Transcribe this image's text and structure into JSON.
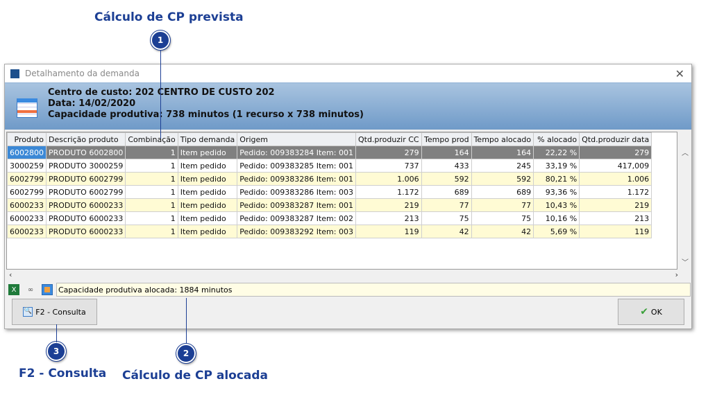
{
  "callouts": {
    "c1": {
      "num": "1",
      "title": "Cálculo de CP prevista"
    },
    "c2": {
      "num": "2",
      "title": "Cálculo de CP alocada"
    },
    "c3": {
      "num": "3",
      "title": "F2 - Consulta"
    }
  },
  "window": {
    "title": "Detalhamento da demanda",
    "close": "✕"
  },
  "header": {
    "centro": "Centro de custo: 202 CENTRO DE CUSTO 202",
    "data": "Data: 14/02/2020",
    "capacidade": "Capacidade produtiva: 738 minutos (1 recurso x 738 minutos)"
  },
  "table": {
    "columns": [
      "Produto",
      "Descrição produto",
      "Combinação",
      "Tipo demanda",
      "Origem",
      "Qtd.produzir CC",
      "Tempo prod",
      "Tempo alocado",
      "% alocado",
      "Qtd.produzir data"
    ],
    "rows": [
      [
        "6002800",
        "PRODUTO 6002800",
        "1",
        "Item pedido",
        "Pedido: 009383284 Item: 001",
        "279",
        "164",
        "164",
        "22,22 %",
        "279"
      ],
      [
        "3000259",
        "PRODUTO 3000259",
        "1",
        "Item pedido",
        "Pedido: 009383285 Item: 001",
        "737",
        "433",
        "245",
        "33,19 %",
        "417,009"
      ],
      [
        "6002799",
        "PRODUTO 6002799",
        "1",
        "Item pedido",
        "Pedido: 009383286 Item: 001",
        "1.006",
        "592",
        "592",
        "80,21 %",
        "1.006"
      ],
      [
        "6002799",
        "PRODUTO 6002799",
        "1",
        "Item pedido",
        "Pedido: 009383286 Item: 003",
        "1.172",
        "689",
        "689",
        "93,36 %",
        "1.172"
      ],
      [
        "6000233",
        "PRODUTO 6000233",
        "1",
        "Item pedido",
        "Pedido: 009383287 Item: 001",
        "219",
        "77",
        "77",
        "10,43 %",
        "219"
      ],
      [
        "6000233",
        "PRODUTO 6000233",
        "1",
        "Item pedido",
        "Pedido: 009383287 Item: 002",
        "213",
        "75",
        "75",
        "10,16 %",
        "213"
      ],
      [
        "6000233",
        "PRODUTO 6000233",
        "1",
        "Item pedido",
        "Pedido: 009383292 Item: 003",
        "119",
        "42",
        "42",
        "5,69 %",
        "119"
      ]
    ]
  },
  "status": {
    "text": "Capacidade produtiva alocada: 1884 minutos",
    "icons": [
      "excel-icon",
      "binoculars-icon",
      "chart-icon"
    ]
  },
  "buttons": {
    "consulta": "F2 - Consulta",
    "ok": "OK"
  }
}
